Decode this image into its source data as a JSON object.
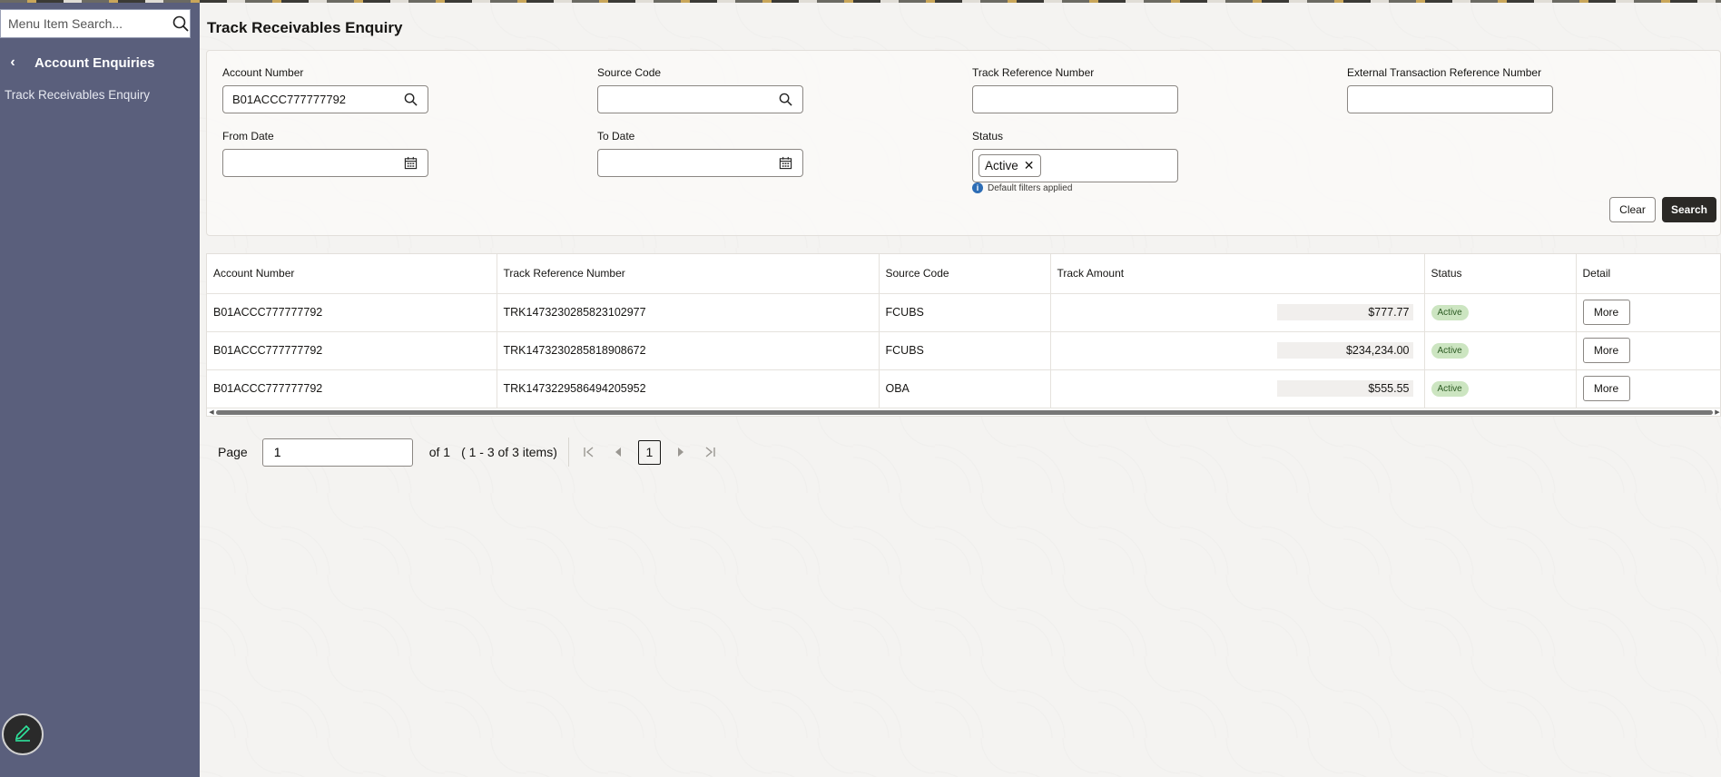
{
  "sidebar": {
    "search_placeholder": "Menu Item Search...",
    "section_title": "Account Enquiries",
    "items": [
      {
        "label": "Track Receivables Enquiry"
      }
    ]
  },
  "page": {
    "title": "Track Receivables Enquiry"
  },
  "filters": {
    "account_number": {
      "label": "Account Number",
      "value": "B01ACCC777777792"
    },
    "source_code": {
      "label": "Source Code",
      "value": ""
    },
    "track_reference": {
      "label": "Track Reference Number",
      "value": ""
    },
    "external_reference": {
      "label": "External Transaction Reference Number",
      "value": ""
    },
    "from_date": {
      "label": "From Date",
      "value": ""
    },
    "to_date": {
      "label": "To Date",
      "value": ""
    },
    "status": {
      "label": "Status",
      "chip": "Active",
      "hint": "Default filters applied"
    },
    "clear_label": "Clear",
    "search_label": "Search"
  },
  "table": {
    "columns": [
      "Account Number",
      "Track Reference Number",
      "Source Code",
      "Track Amount",
      "Status",
      "Detail"
    ],
    "rows": [
      {
        "account": "B01ACCC777777792",
        "track_ref": "TRK1473230285823102977",
        "source": "FCUBS",
        "amount": "$777.77",
        "status": "Active",
        "detail": "More"
      },
      {
        "account": "B01ACCC777777792",
        "track_ref": "TRK1473230285818908672",
        "source": "FCUBS",
        "amount": "$234,234.00",
        "status": "Active",
        "detail": "More"
      },
      {
        "account": "B01ACCC777777792",
        "track_ref": "TRK1473229586494205952",
        "source": "OBA",
        "amount": "$555.55",
        "status": "Active",
        "detail": "More"
      }
    ]
  },
  "pagination": {
    "page_label": "Page",
    "page_value": "1",
    "of_label": "of 1",
    "items_label": "( 1 - 3 of 3 items)",
    "current_page": "1"
  },
  "colors": {
    "sidebar": "#5a5f7c",
    "primary_button": "#2b2926",
    "status_badge": "#cce5c1"
  },
  "icons": [
    "search-icon",
    "chevron-left-icon",
    "calendar-icon",
    "close-icon",
    "info-icon",
    "first-page-icon",
    "previous-page-icon",
    "next-page-icon",
    "last-page-icon",
    "edit-pencil-icon"
  ]
}
